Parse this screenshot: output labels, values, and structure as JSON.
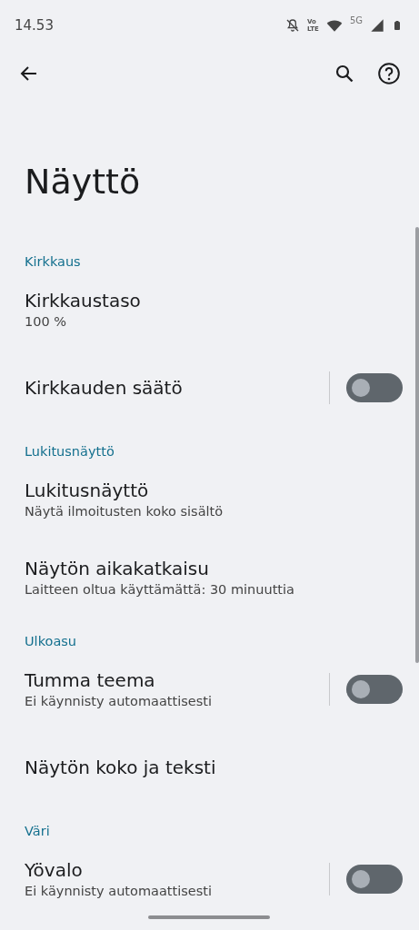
{
  "status_bar": {
    "time": "14.53",
    "volte_top": "Vo",
    "volte_bottom": "LTE",
    "network_type": "5G"
  },
  "title": "Näyttö",
  "sections": [
    {
      "header": "Kirkkaus",
      "items": [
        {
          "kind": "link",
          "title": "Kirkkaustaso",
          "subtitle": "100 %"
        },
        {
          "kind": "toggle",
          "title": "Kirkkauden säätö",
          "on": false
        }
      ]
    },
    {
      "header": "Lukitusnäyttö",
      "items": [
        {
          "kind": "link",
          "title": "Lukitusnäyttö",
          "subtitle": "Näytä ilmoitusten koko sisältö"
        },
        {
          "kind": "link",
          "title": "Näytön aikakatkaisu",
          "subtitle": "Laitteen oltua käyttämättä: 30 minuuttia"
        }
      ]
    },
    {
      "header": "Ulkoasu",
      "items": [
        {
          "kind": "toggle",
          "title": "Tumma teema",
          "subtitle": "Ei käynnisty automaattisesti",
          "on": false
        },
        {
          "kind": "link",
          "title": "Näytön koko ja teksti"
        }
      ]
    },
    {
      "header": "Väri",
      "items": [
        {
          "kind": "toggle",
          "title": "Yövalo",
          "subtitle": "Ei käynnisty automaattisesti",
          "on": false
        }
      ]
    }
  ]
}
